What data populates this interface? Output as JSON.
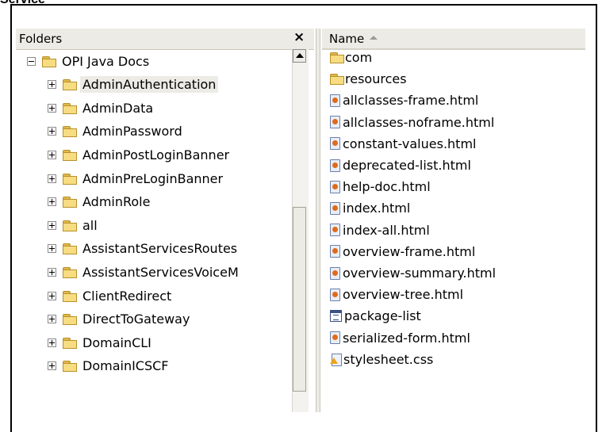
{
  "document": {
    "label": "Service"
  },
  "folders_pane": {
    "title": "Folders",
    "close_glyph": "×",
    "tree": [
      {
        "label": "OPI Java Docs",
        "expander": "minus",
        "level": 0,
        "selected": false
      },
      {
        "label": "AdminAuthentication",
        "expander": "plus",
        "level": 1,
        "selected": true
      },
      {
        "label": "AdminData",
        "expander": "plus",
        "level": 1,
        "selected": false
      },
      {
        "label": "AdminPassword",
        "expander": "plus",
        "level": 1,
        "selected": false
      },
      {
        "label": "AdminPostLoginBanner",
        "expander": "plus",
        "level": 1,
        "selected": false
      },
      {
        "label": "AdminPreLoginBanner",
        "expander": "plus",
        "level": 1,
        "selected": false
      },
      {
        "label": "AdminRole",
        "expander": "plus",
        "level": 1,
        "selected": false
      },
      {
        "label": "all",
        "expander": "plus",
        "level": 1,
        "selected": false
      },
      {
        "label": "AssistantServicesRoutes",
        "expander": "plus",
        "level": 1,
        "selected": false
      },
      {
        "label": "AssistantServicesVoiceM",
        "expander": "plus",
        "level": 1,
        "selected": false
      },
      {
        "label": "ClientRedirect",
        "expander": "plus",
        "level": 1,
        "selected": false
      },
      {
        "label": "DirectToGateway",
        "expander": "plus",
        "level": 1,
        "selected": false
      },
      {
        "label": "DomainCLI",
        "expander": "plus",
        "level": 1,
        "selected": false
      },
      {
        "label": "DomainICSCF",
        "expander": "plus",
        "level": 1,
        "selected": false
      }
    ]
  },
  "file_pane": {
    "column_header": "Name",
    "files": [
      {
        "name": "com",
        "icon": "folder-icon"
      },
      {
        "name": "resources",
        "icon": "folder-icon"
      },
      {
        "name": "allclasses-frame.html",
        "icon": "html-file-icon"
      },
      {
        "name": "allclasses-noframe.html",
        "icon": "html-file-icon"
      },
      {
        "name": "constant-values.html",
        "icon": "html-file-icon"
      },
      {
        "name": "deprecated-list.html",
        "icon": "html-file-icon"
      },
      {
        "name": "help-doc.html",
        "icon": "html-file-icon"
      },
      {
        "name": "index.html",
        "icon": "html-file-icon"
      },
      {
        "name": "index-all.html",
        "icon": "html-file-icon"
      },
      {
        "name": "overview-frame.html",
        "icon": "html-file-icon"
      },
      {
        "name": "overview-summary.html",
        "icon": "html-file-icon"
      },
      {
        "name": "overview-tree.html",
        "icon": "html-file-icon"
      },
      {
        "name": "package-list",
        "icon": "list-file-icon"
      },
      {
        "name": "serialized-form.html",
        "icon": "html-file-icon"
      },
      {
        "name": "stylesheet.css",
        "icon": "css-file-icon"
      }
    ]
  },
  "colors": {
    "pane_header_bg": "#ecebe5",
    "folder_fill": "#f7dc82",
    "selection_bg": "#ecebe5"
  }
}
